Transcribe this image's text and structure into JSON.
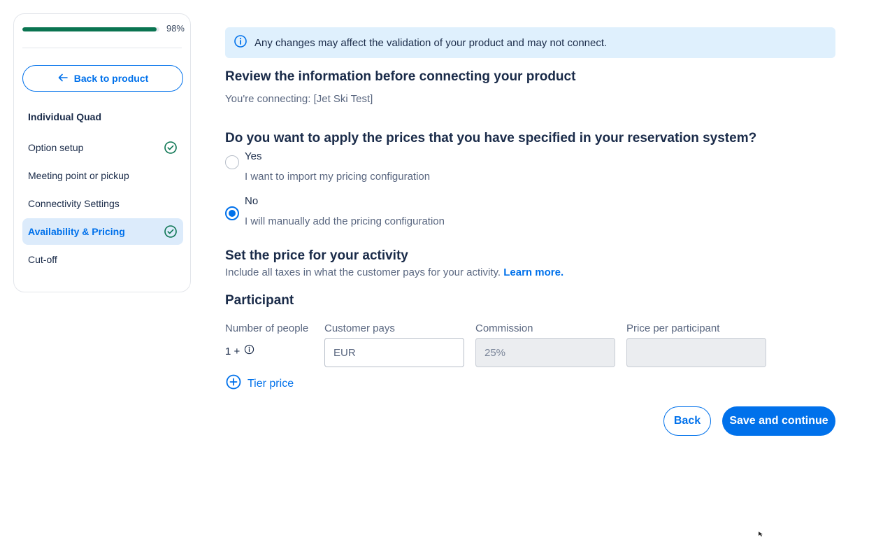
{
  "sidebar": {
    "progress_percent": 98,
    "progress_label": "98%",
    "back_label": "Back to product",
    "items": [
      {
        "label": "Individual Quad",
        "completed": false,
        "active": false
      },
      {
        "label": "Option setup",
        "completed": true,
        "active": false
      },
      {
        "label": "Meeting point or pickup",
        "completed": false,
        "active": false
      },
      {
        "label": "Connectivity Settings",
        "completed": false,
        "active": false
      },
      {
        "label": "Availability & Pricing",
        "completed": true,
        "active": true
      },
      {
        "label": "Cut-off",
        "completed": false,
        "active": false
      }
    ]
  },
  "main": {
    "banner_text": "Any changes may affect the validation of your product and may not connect.",
    "review_heading": "Review the information before connecting your product",
    "connecting_text": "You're connecting: [Jet Ski Test]",
    "question": "Do you want to apply the prices that you have specified in your reservation system?",
    "options": [
      {
        "title": "Yes",
        "subtitle": "I want to import my pricing configuration",
        "selected": false
      },
      {
        "title": "No",
        "subtitle": "I will manually add the pricing configuration",
        "selected": true
      }
    ],
    "price_heading": "Set the price for your activity",
    "price_subtext": "Include all taxes in what the customer pays for your activity.",
    "learn_more": "Learn more.",
    "participant_heading": "Participant",
    "columns": {
      "people": "Number of people",
      "customer_pays": "Customer pays",
      "commission": "Commission",
      "price_per_participant": "Price per participant"
    },
    "people_value": "1 +",
    "customer_pays_placeholder": "EUR",
    "commission_value": "25%",
    "price_per_participant_value": "",
    "tier_price_label": "Tier price",
    "back_button": "Back",
    "save_button": "Save and continue"
  },
  "colors": {
    "accent": "#0071eb",
    "progress": "#0a7451",
    "banner_bg": "#dff0fd",
    "active_item_bg": "#dcebfb"
  }
}
